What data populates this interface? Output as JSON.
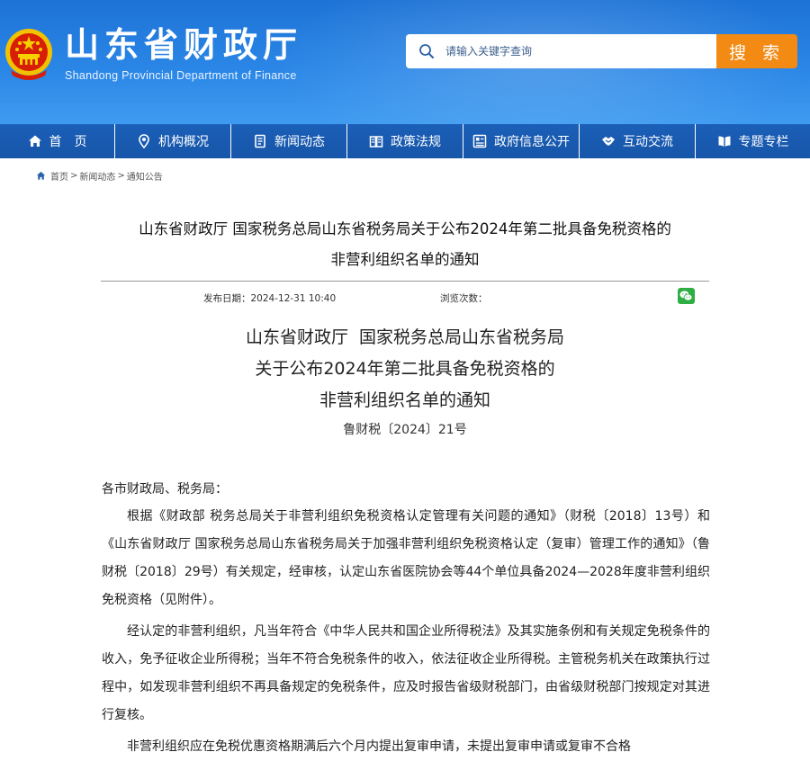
{
  "header": {
    "site_title": "山东省财政厅",
    "site_subtitle": "Shandong Provincial Department of Finance",
    "emblem_icon": "national-emblem-icon",
    "search": {
      "placeholder": "请输入关键字查询",
      "button_label": "搜 索"
    },
    "colors": {
      "header_blue": "#2a86e6",
      "nav_blue": "#1b5fb8",
      "search_button": "#f28a14"
    }
  },
  "nav": {
    "items": [
      {
        "label": "首　页",
        "icon": "home-icon"
      },
      {
        "label": "机构概况",
        "icon": "location-pin-icon"
      },
      {
        "label": "新闻动态",
        "icon": "document-icon"
      },
      {
        "label": "政策法规",
        "icon": "book-icon"
      },
      {
        "label": "政府信息公开",
        "icon": "grid-list-icon"
      },
      {
        "label": "互动交流",
        "icon": "handshake-icon"
      },
      {
        "label": "专题专栏",
        "icon": "open-book-icon"
      }
    ]
  },
  "breadcrumb": {
    "items": [
      "首页",
      "新闻动态",
      "通知公告"
    ],
    "separator": ">"
  },
  "article": {
    "title_line1": "山东省财政厅 国家税务总局山东省税务局关于公布2024年第二批具备免税资格的",
    "title_line2": "非营利组织名单的通知",
    "publish_label": "发布日期：",
    "publish_date": "2024-12-31 10:40",
    "views_label": "浏览次数：",
    "views_value": "",
    "share_icon": "wechat-icon"
  },
  "document": {
    "heading_lines": [
      "山东省财政厅  国家税务总局山东省税务局",
      "关于公布2024年第二批具备免税资格的",
      "非营利组织名单的通知"
    ],
    "doc_number": "鲁财税〔2024〕21号",
    "salutation": "各市财政局、税务局：",
    "paragraphs": [
      "根据《财政部 税务总局关于非营利组织免税资格认定管理有关问题的通知》（财税〔2018〕13号）和《山东省财政厅 国家税务总局山东省税务局关于加强非营利组织免税资格认定（复审）管理工作的通知》（鲁财税〔2018〕29号）有关规定，经审核，认定山东省医院协会等44个单位具备2024—2028年度非营利组织免税资格（见附件）。",
      "经认定的非营利组织，凡当年符合《中华人民共和国企业所得税法》及其实施条例和有关规定免税条件的收入，免予征收企业所得税；当年不符合免税条件的收入，依法征收企业所得税。主管税务机关在政策执行过程中，如发现非营利组织不再具备规定的免税条件，应及时报告省级财税部门，由省级财税部门按规定对其进行复核。",
      "非营利组织应在免税优惠资格期满后六个月内提出复审申请，未提出复审申请或复审不合格"
    ]
  }
}
